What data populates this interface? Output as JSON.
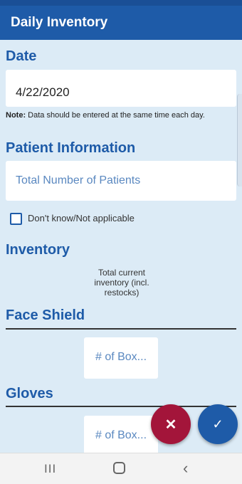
{
  "app_bar": {
    "title": "Daily Inventory"
  },
  "date": {
    "label": "Date",
    "value": "4/22/2020",
    "note_bold": "Note:",
    "note_text": " Data should be entered at the same time each day."
  },
  "patient": {
    "label": "Patient Information",
    "placeholder": "Total Number of Patients",
    "checkbox_label": "Don't know/Not applicable",
    "checkbox_checked": false
  },
  "inventory": {
    "label": "Inventory",
    "column_header": "Total current inventory (incl. restocks)",
    "items": [
      {
        "label": "Face Shield",
        "placeholder": "# of Box..."
      },
      {
        "label": "Gloves",
        "placeholder": "# of Box..."
      }
    ]
  },
  "actions": {
    "cancel_glyph": "✕",
    "confirm_glyph": "✓"
  },
  "colors": {
    "primary": "#1e5ba8",
    "cancel": "#a3153a",
    "background": "#dcebf6"
  },
  "icons": {
    "cancel": "close-icon",
    "confirm": "check-icon",
    "recents": "recents-icon",
    "home": "home-icon",
    "back": "back-icon"
  }
}
